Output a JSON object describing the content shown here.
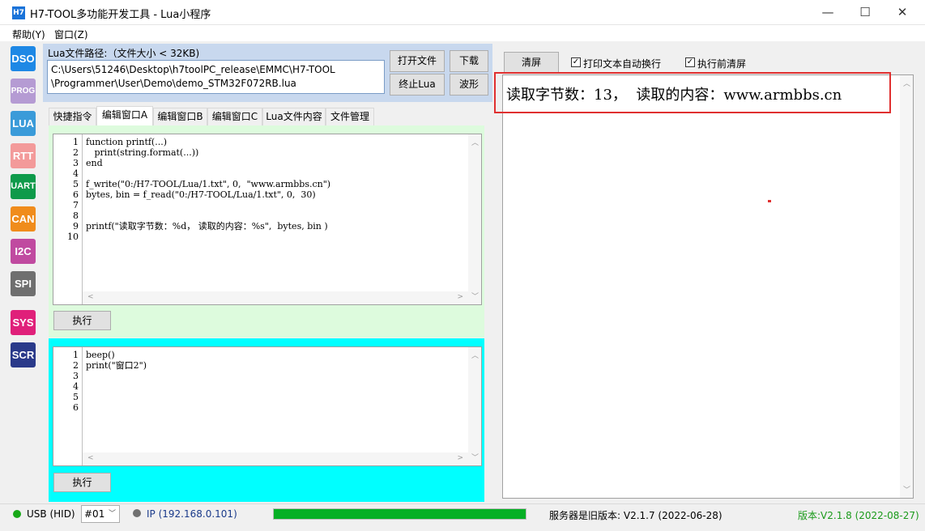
{
  "window": {
    "icon_text": "H7",
    "title": "H7-TOOL多功能开发工具 - Lua小程序",
    "min_glyph": "—",
    "max_glyph": "☐",
    "close_glyph": "✕"
  },
  "menu": {
    "items": [
      {
        "label": "帮助(Y)"
      },
      {
        "label": "窗口(Z)"
      }
    ]
  },
  "nav": {
    "items": [
      {
        "label": "DSO",
        "color": "#1e88e5"
      },
      {
        "label": "PROG",
        "color": "#b59bd3"
      },
      {
        "label": "LUA",
        "color": "#3a9bd9"
      },
      {
        "label": "RTT",
        "color": "#f39a9a"
      },
      {
        "label": "UART",
        "color": "#0e9a4a"
      },
      {
        "label": "CAN",
        "color": "#f08c1c"
      },
      {
        "label": "I2C",
        "color": "#c04aa0"
      },
      {
        "label": "SPI",
        "color": "#6f6f6f"
      },
      {
        "label": "SYS",
        "color": "#e0207a"
      },
      {
        "label": "SCR",
        "color": "#2a3a8a"
      }
    ]
  },
  "path_panel": {
    "label": "Lua文件路径:（文件大小 < 32KB)",
    "path_line1": "C:\\Users\\51246\\Desktop\\h7toolPC_release\\EMMC\\H7-TOOL",
    "path_line2": "\\Programmer\\User\\Demo\\demo_STM32F072RB.lua",
    "open_file": "打开文件",
    "download": "下载",
    "stop_lua": "终止Lua",
    "waveform": "波形"
  },
  "tabs": [
    {
      "label": "快捷指令"
    },
    {
      "label": "编辑窗口A"
    },
    {
      "label": "编辑窗口B"
    },
    {
      "label": "编辑窗口C"
    },
    {
      "label": "Lua文件内容"
    },
    {
      "label": "文件管理"
    }
  ],
  "editor_a": {
    "line_numbers": [
      "1",
      "2",
      "3",
      "4",
      "5",
      "6",
      "7",
      "8",
      "9",
      "10"
    ],
    "lines": [
      "function printf(...)",
      "   print(string.format(...))",
      "end",
      "",
      "f_write(\"0:/H7-TOOL/Lua/1.txt\", 0,  \"www.armbbs.cn\")",
      "bytes, bin = f_read(\"0:/H7-TOOL/Lua/1.txt\", 0,  30)",
      "",
      "",
      "printf(\"读取字节数：%d， 读取的内容：%s\",  bytes, bin )",
      ""
    ],
    "run_label": "执行"
  },
  "editor_b": {
    "line_numbers": [
      "1",
      "2",
      "3",
      "4",
      "5",
      "6"
    ],
    "lines": [
      "beep()",
      "print(\"窗口2\")",
      "",
      "",
      "",
      ""
    ],
    "run_label": "执行"
  },
  "output_panel": {
    "clear_label": "清屏",
    "wrap_label": "打印文本自动换行",
    "wrap_checked": true,
    "clear_before_run_label": "执行前清屏",
    "clear_before_run_checked": true,
    "output_text": "读取字节数：13，  读取的内容：www.armbbs.cn"
  },
  "status": {
    "usb": "USB (HID)",
    "port": "#01",
    "ip": "IP (192.168.0.101)",
    "progress_fraction": 1.0,
    "server_msg": "服务器是旧版本: V2.1.7 (2022-06-28)",
    "version": "版本:V2.1.8 (2022-08-27)"
  },
  "colors": {
    "accent": "#0078d7",
    "highlight_border": "#e03030",
    "progress": "#06b025",
    "version_text": "#1a9a1a",
    "usb_dot": "#18a818",
    "ip_dot": "#707070",
    "editor_a_bg": "#ddfbdd",
    "editor_b_bg": "#00ffff"
  }
}
